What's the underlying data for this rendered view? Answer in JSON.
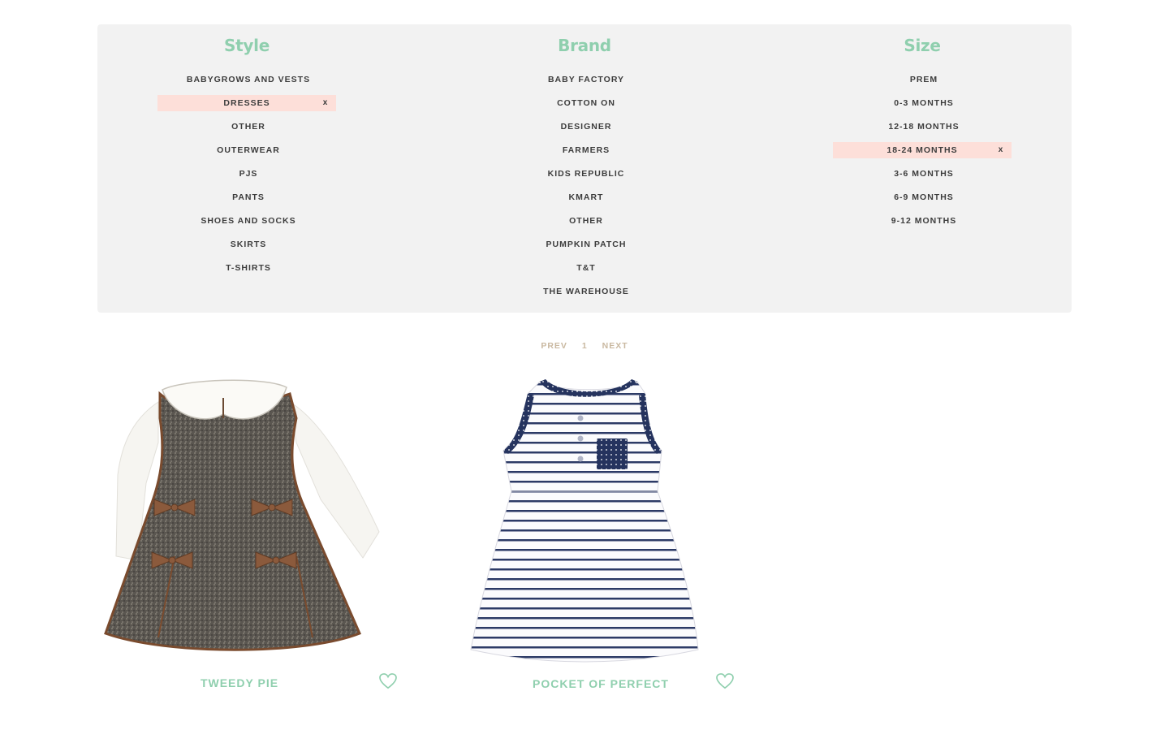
{
  "filters": {
    "style": {
      "heading": "Style",
      "items": [
        "BABYGROWS AND VESTS",
        "DRESSES",
        "OTHER",
        "OUTERWEAR",
        "PJS",
        "PANTS",
        "SHOES AND SOCKS",
        "SKIRTS",
        "T-SHIRTS"
      ],
      "active": "DRESSES"
    },
    "brand": {
      "heading": "Brand",
      "items": [
        "BABY FACTORY",
        "COTTON ON",
        "DESIGNER",
        "FARMERS",
        "KIDS REPUBLIC",
        "KMART",
        "OTHER",
        "PUMPKIN PATCH",
        "T&T",
        "THE WAREHOUSE"
      ],
      "active": null
    },
    "size": {
      "heading": "Size",
      "items": [
        "PREM",
        "0-3 MONTHS",
        "12-18 MONTHS",
        "18-24 MONTHS",
        "3-6 MONTHS",
        "6-9 MONTHS",
        "9-12 MONTHS"
      ],
      "active": "18-24 MONTHS"
    },
    "remove_label": "x"
  },
  "pagination": {
    "prev": "PREV",
    "page": "1",
    "next": "NEXT"
  },
  "products": [
    {
      "name": "TWEEDY PIE",
      "image": "grey-tweed-pinafore-dress",
      "favorite_icon": "heart-outline-icon"
    },
    {
      "name": "POCKET OF PERFECT",
      "image": "navy-striped-sleeveless-dress",
      "favorite_icon": "heart-outline-icon"
    }
  ],
  "colors": {
    "accent_green": "#8fcfae",
    "active_filter_bg": "#fddfd9",
    "panel_bg": "#f2f2f2",
    "pagination_text": "#c9b8a0"
  }
}
